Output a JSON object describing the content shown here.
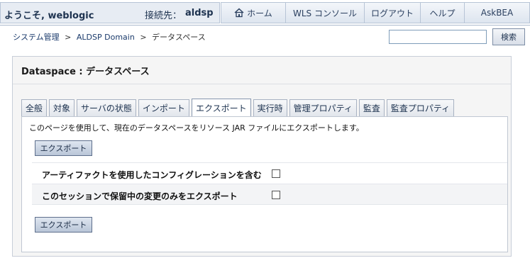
{
  "header": {
    "welcome": "ようこそ, weblogic",
    "connection_label": "接続先：",
    "connection_value": "aldsp",
    "nav": [
      {
        "label": "ホーム",
        "icon": "home-icon"
      },
      {
        "label": "WLS コンソール"
      },
      {
        "label": "ログアウト"
      },
      {
        "label": "ヘルプ"
      },
      {
        "label": "AskBEA"
      }
    ]
  },
  "breadcrumb": {
    "items": [
      "システム管理",
      "ALDSP Domain",
      "データスペース"
    ],
    "separator": ">"
  },
  "search": {
    "value": "",
    "button_label": "検索"
  },
  "page": {
    "title": "Dataspace : データスペース",
    "tabs": [
      {
        "label": "全般",
        "active": false
      },
      {
        "label": "対象",
        "active": false
      },
      {
        "label": "サーバの状態",
        "active": false
      },
      {
        "label": "インポート",
        "active": false
      },
      {
        "label": "エクスポート",
        "active": true
      },
      {
        "label": "実行時",
        "active": false
      },
      {
        "label": "管理プロパティ",
        "active": false
      },
      {
        "label": "監査",
        "active": false
      },
      {
        "label": "監査プロパティ",
        "active": false
      }
    ],
    "description": "このページを使用して、現在のデータスペースをリソース JAR ファイルにエクスポートします。",
    "export_button_label": "エクスポート",
    "options": [
      {
        "label": "アーティファクトを使用したコンフィグレーションを含む",
        "checked": false
      },
      {
        "label": "このセッションで保留中の変更のみをエクスポート",
        "checked": false
      }
    ]
  },
  "colors": {
    "header_bg": "#e7ecf3",
    "nav_text": "#2a3f5f",
    "panel_bg": "#f5f5f5",
    "button_bg": "#b9c6d8"
  }
}
